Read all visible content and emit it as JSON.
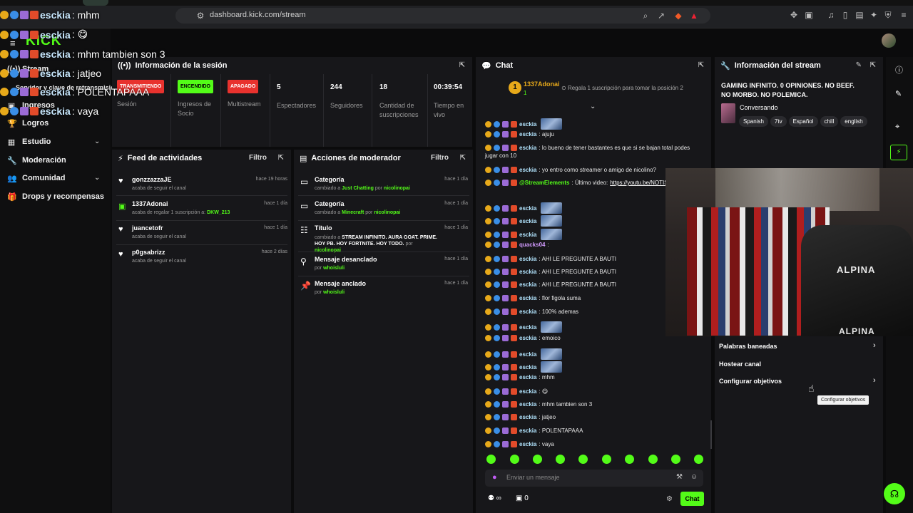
{
  "browser": {
    "url": "dashboard.kick.com/stream"
  },
  "overlay": {
    "brand": "KICK",
    "lines": [
      {
        "user": "esckia",
        "text": ": mhm"
      },
      {
        "user": "esckia",
        "text": ": 😋"
      },
      {
        "user": "esckia",
        "text": ": mhm tambien son 3"
      },
      {
        "user": "esckia",
        "text": ": jatjeo"
      },
      {
        "user": "esckia",
        "text": ": POLENTAPAAA"
      },
      {
        "user": "esckia",
        "text": ": vaya"
      }
    ]
  },
  "sidebar": {
    "items": [
      {
        "label": "Stream",
        "icon": "stream-icon"
      },
      {
        "label": "Servidor y clave de retransmisión",
        "icon": "key-icon"
      },
      {
        "label": "Ingresos",
        "icon": "money-icon"
      },
      {
        "label": "Logros",
        "icon": "trophy-icon"
      },
      {
        "label": "Estudio",
        "icon": "studio-icon"
      },
      {
        "label": "Moderación",
        "icon": "wrench-icon"
      },
      {
        "label": "Comunidad",
        "icon": "community-icon"
      },
      {
        "label": "Drops y recompensas",
        "icon": "gift-icon"
      }
    ]
  },
  "session": {
    "title": "Información de la sesión",
    "stats": [
      {
        "pill": "TRANSMITIENDO",
        "label": "Sesión",
        "color": "#e8322e"
      },
      {
        "pill": "ENCENDIDO",
        "label": "Ingresos de Socio",
        "color": "#53fc18"
      },
      {
        "pill": "APAGADO",
        "label": "Multistream",
        "color": "#e8322e"
      },
      {
        "value": "5",
        "label": "Espectadores"
      },
      {
        "value": "244",
        "label": "Seguidores"
      },
      {
        "value": "18",
        "label": "Cantidad de suscripciones"
      },
      {
        "value": "00:39:54",
        "label": "Tiempo en vivo"
      }
    ]
  },
  "activity": {
    "title": "Feed de actividades",
    "filter": "Filtro",
    "rows": [
      {
        "user": "gonzzazzaJE",
        "sub": "acaba de seguir el canal",
        "time": "hace 19 horas"
      },
      {
        "user": "1337Adonai",
        "sub": "acaba de regalar 1 suscripción a:",
        "target": "DKW_213",
        "time": "hace 1 día"
      },
      {
        "user": "juancetofr",
        "sub": "acaba de seguir el canal",
        "time": "hace 1 día"
      },
      {
        "user": "p0gsabrizz",
        "sub": "acaba de seguir el canal",
        "time": "hace 2 días"
      }
    ]
  },
  "modactions": {
    "title": "Acciones de moderador",
    "filter": "Filtro",
    "rows": [
      {
        "title": "Categoría",
        "pre": "cambiado a",
        "hl": "Just Chatting",
        "por": "por",
        "mod": "nicolinopai",
        "time": "hace 1 día"
      },
      {
        "title": "Categoría",
        "pre": "cambiado a",
        "hl": "Minecraft",
        "por": "por",
        "mod": "nicolinopai",
        "time": "hace 1 día"
      },
      {
        "title": "Título",
        "pre": "cambiado a",
        "hl": "STREAM INFINITO. AURA GOAT. PRIME. HOY PB. HOY FORTNITE. HOY TODO.",
        "por": "por",
        "mod": "nicolinopai",
        "time": "hace 1 día"
      },
      {
        "title": "Mensaje desanclado",
        "pre": "",
        "hl": "",
        "por": "por",
        "mod": "whoisluli",
        "time": "hace 1 día"
      },
      {
        "title": "Mensaje anclado",
        "pre": "",
        "hl": "",
        "por": "por",
        "mod": "whoisluli",
        "time": "hace 1 día"
      }
    ]
  },
  "chat": {
    "title": "Chat",
    "leader": {
      "user": "1337Adonai",
      "count": "1",
      "cta": "Regala 1 suscripción para tomar la posición 2"
    },
    "messages": [
      {
        "user": "esckia",
        "text": "",
        "emote": true
      },
      {
        "user": "esckia",
        "text": ": ajuju"
      },
      {
        "user": "esckia",
        "text": ": lo bueno de tener bastantes es que si se bajan total podes"
      },
      {
        "user": "",
        "text": "jugar con 10"
      },
      {
        "user": "esckia",
        "text": ": yo entro como streamer o amigo de nicolino?"
      },
      {
        "user": "@StreamElements",
        "text": ": Último video: ",
        "link": "https://youtu.be/NOTIS"
      },
      {
        "user": "esckia",
        "text": "",
        "emote": true
      },
      {
        "user": "esckia",
        "text": "",
        "emote": true
      },
      {
        "user": "esckia",
        "text": "",
        "emote": true
      },
      {
        "user": "quacks04",
        "text": ":"
      },
      {
        "user": "esckia",
        "text": ": AHI LE PREGUNTE A BAUTI"
      },
      {
        "user": "esckia",
        "text": ": AHI LE PREGUNTE A BAUTI"
      },
      {
        "user": "esckia",
        "text": ": AHI LE PREGUNTE A BAUTI"
      },
      {
        "user": "esckia",
        "text": ": flor figola suma"
      },
      {
        "user": "esckia",
        "text": ": 100% ademas"
      },
      {
        "user": "esckia",
        "text": "",
        "emote": true
      },
      {
        "user": "esckia",
        "text": ": emoico"
      },
      {
        "user": "esckia",
        "text": "",
        "emote": true
      },
      {
        "user": "esckia",
        "text": "",
        "emote": true
      },
      {
        "user": "esckia",
        "text": ": mhm"
      },
      {
        "user": "esckia",
        "text": ": 😋"
      },
      {
        "user": "esckia",
        "text": ": mhm tambien son 3"
      },
      {
        "user": "esckia",
        "text": ": jatjeo"
      },
      {
        "user": "esckia",
        "text": ": POLENTAPAAA"
      },
      {
        "user": "esckia",
        "text": ": vaya"
      }
    ],
    "input_placeholder": "Enviar un mensaje",
    "viewers": "∞",
    "points": "0",
    "send_label": "Chat"
  },
  "streaminfo": {
    "title": "Información del stream",
    "stream_title": "GAMING INFINITO. 0 OPINIONES. NO BEEF. NO MORBO. NO POLEMICA.",
    "category": "Conversando",
    "tags": [
      "Spanish",
      "7tv",
      "Español",
      "chill",
      "english"
    ],
    "links": [
      "Palabras baneadas",
      "Hostear canal",
      "Configurar objetivos"
    ],
    "tooltip": "Configurar objetivos"
  },
  "colors": {
    "kick_green": "#53fc18",
    "live_red": "#e8322e",
    "panel_bg": "#17171a"
  }
}
